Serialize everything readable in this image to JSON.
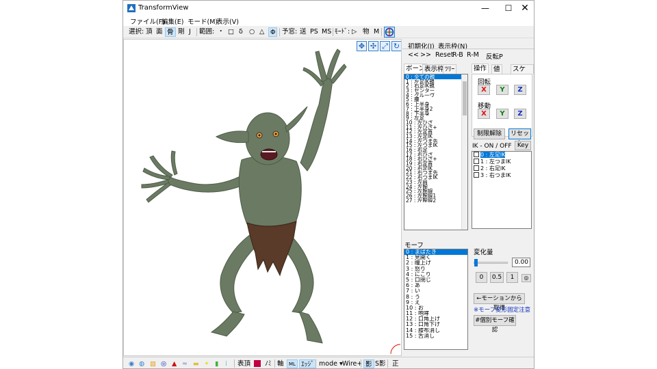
{
  "window": {
    "title": "TransformView"
  },
  "menu": [
    "ファイル(F)",
    "編集(E)",
    "モード(M)",
    "表示(V)"
  ],
  "toolbar": {
    "select_label": "選択:",
    "select_items": [
      "頂",
      "面",
      "骨",
      "剛",
      "J"
    ],
    "range_label": "範囲:",
    "range_items": [
      "・",
      "□",
      "δ",
      "○",
      "△",
      "Φ"
    ],
    "ruby_label": "予窓:",
    "ruby_items": [
      "送",
      "PS",
      "MS"
    ],
    "mode_label": "ﾓｰﾄﾞ:",
    "mode_items": [
      "▷",
      "物",
      "M"
    ]
  },
  "right_top": {
    "buttons_row1": [
      "初期化(I)",
      "表示枠(N)"
    ],
    "buttons_row2": [
      "<<",
      ">>",
      "Reset",
      "R-B",
      "R-M",
      "反転P"
    ]
  },
  "bone_tabs": [
    "ボーン",
    "表示枠",
    "ﾂﾘｰ"
  ],
  "bones": [
    "0 : 全ての親",
    "1 : 左足IK親",
    "2 : 右足IK親",
    "3 : センター",
    "4 : グルーヴ",
    "5 : 腰",
    "6 : 上半身",
    "7 : 上半身2",
    "8 : 下半身",
    "9 : 左足",
    "10 : 左ひざ",
    "11 : 左ひざ+",
    "12 : 左足首",
    "13 : 左足IK",
    "14 : 左つま先",
    "15 : 左つまIK",
    "16 : 右足",
    "17 : 右ひざ",
    "18 : 右ひざ+",
    "19 : 右足首",
    "20 : 右足IK",
    "21 : 右つま先",
    "22 : 右つまIK",
    "23 : 左肩",
    "24 : 左腕",
    "25 : 左腕捩",
    "26 : 左腕捩1",
    "27 : 左腕捩2"
  ],
  "op_tabs": [
    "操作",
    "値",
    "スケール"
  ],
  "rotate_label": "回転",
  "move_label": "移動",
  "xyz": [
    "X",
    "Y",
    "Z"
  ],
  "limit_release": "制限解除",
  "reset": "リセット",
  "ik_label": "IK - ON / OFF",
  "key_label": "Key",
  "ik_items": [
    "0 : 左足IK",
    "1 : 左つまIK",
    "2 : 右足IK",
    "3 : 右つまIK"
  ],
  "morph_label": "モーフ",
  "morphs": [
    "0 : まばたき",
    "1 : 見開く",
    "2 : 瞳上げ",
    "3 : 怒り",
    "4 : にこり",
    "5 : 口閉じ",
    "6 : あ",
    "7 : い",
    "8 : う",
    "9 : え",
    "10 : お",
    "11 : 咆哮",
    "12 : 口角上げ",
    "13 : 口角下げ",
    "14 : 膝布消し",
    "15 : 舌消し"
  ],
  "change_label": "変化量",
  "change_value": "0.00",
  "slider_value": 0,
  "preset_buttons": [
    "0",
    "0.5",
    "1",
    "◎"
  ],
  "motion_button": "←モーションから取得",
  "morph_note": "※モーフ変形固定注意",
  "morph_check_button": "#個別モーフ確認",
  "bottom": {
    "ink_label": "表頂",
    "mi_label": "ﾉﾐ",
    "axis_label": "軸",
    "edge_label": "ｴｯｼﾞ",
    "mode_label": "mode ▾",
    "wire_label": "Wire+",
    "shadow_label": "影",
    "sshadow_label": "S影",
    "right_label": "正"
  },
  "colors": {
    "accent": "#0078d7",
    "x": "#e01010",
    "y": "#108010",
    "z": "#1030c0",
    "skin": "#6b7b63",
    "loincloth": "#5a3a28"
  }
}
